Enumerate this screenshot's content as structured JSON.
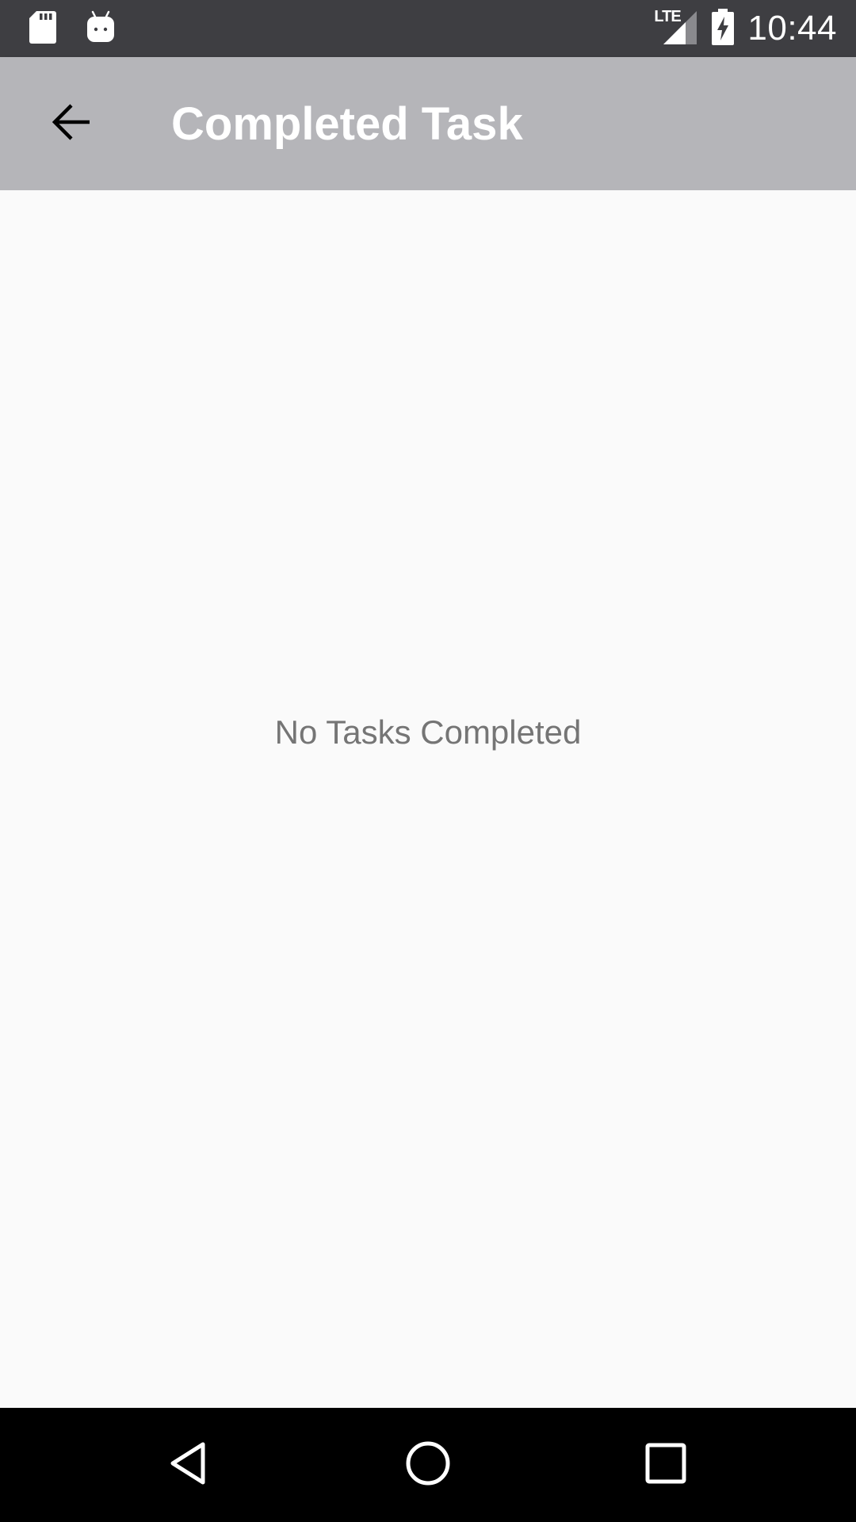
{
  "status_bar": {
    "time": "10:44",
    "network_label": "LTE",
    "icons": [
      "sd-card-icon",
      "android-icon",
      "lte-signal-icon",
      "battery-charging-icon"
    ]
  },
  "app_bar": {
    "title": "Completed Task",
    "back_icon": "arrow-back-icon",
    "background_color": "#b5b5b9"
  },
  "content": {
    "empty_message": "No Tasks Completed"
  },
  "nav_bar": {
    "buttons": [
      "back-triangle-icon",
      "home-circle-icon",
      "recents-square-icon"
    ]
  }
}
